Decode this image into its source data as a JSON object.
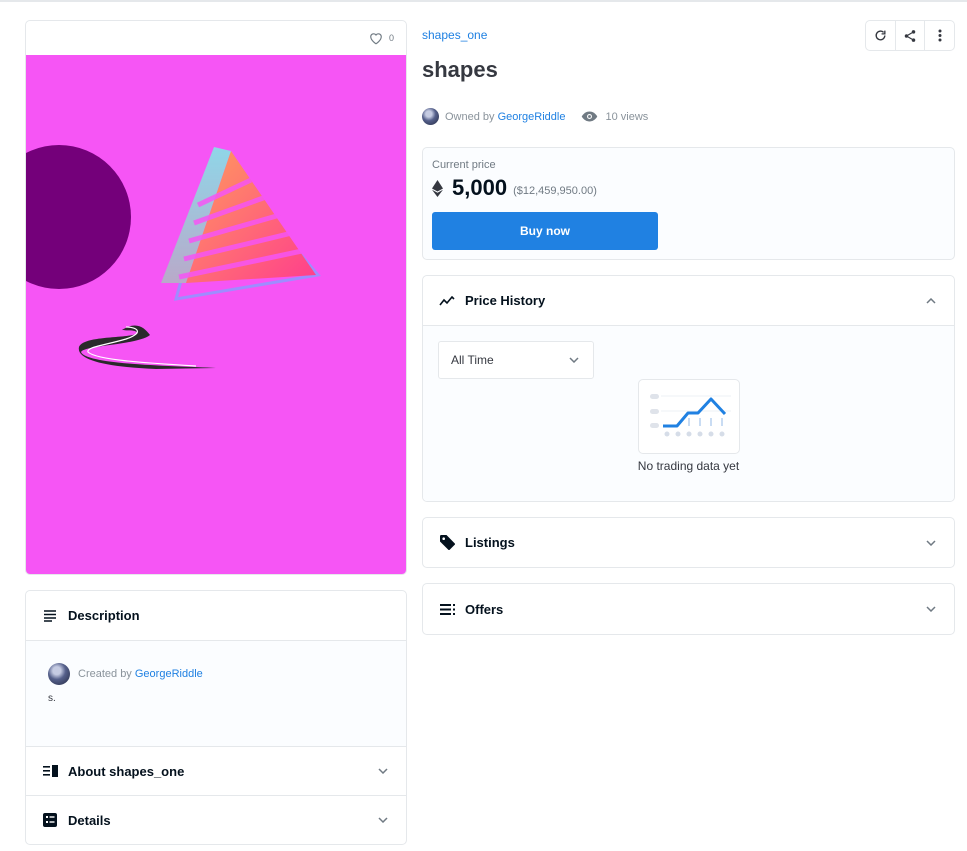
{
  "image_card": {
    "favorites_count": "0"
  },
  "description": {
    "title": "Description",
    "created_by_prefix": "Created by",
    "creator": "GeorgeRiddle",
    "text": "s.",
    "about_label": "About shapes_one",
    "details_label": "Details"
  },
  "collection": {
    "name": "shapes_one"
  },
  "item": {
    "title": "shapes",
    "owned_by_prefix": "Owned by",
    "owner": "GeorgeRiddle",
    "views": "10 views"
  },
  "price": {
    "label": "Current price",
    "amount": "5,000",
    "usd": "($12,459,950.00)",
    "buy_label": "Buy now",
    "accent": "#2081e2"
  },
  "price_history": {
    "title": "Price History",
    "range": "All Time",
    "empty_text": "No trading data yet"
  },
  "listings": {
    "title": "Listings"
  },
  "offers": {
    "title": "Offers"
  },
  "icons": {
    "favorite": "heart-icon",
    "refresh": "refresh-icon",
    "share": "share-icon",
    "more": "more-vertical-icon",
    "views": "eye-icon",
    "currency": "ethereum-icon",
    "description": "lines-icon",
    "about": "list-icon",
    "details": "details-icon",
    "history": "trend-icon",
    "listings": "tag-icon",
    "offers": "list-icon"
  },
  "colors": {
    "art_background": "#f655f5",
    "link": "#2081e2"
  }
}
